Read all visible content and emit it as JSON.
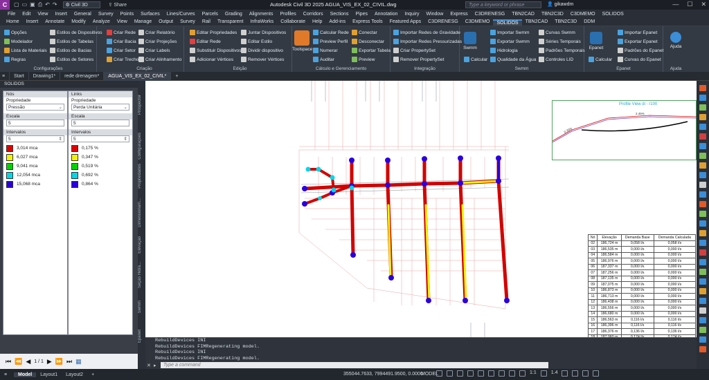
{
  "titlebar": {
    "logo": "C",
    "workspace": "Civil 3D",
    "share": "Share",
    "title": "Autodesk Civil 3D 2025   AGUA_VIS_EX_02_CIVIL.dwg",
    "search_placeholder": "Type a keyword or phrase",
    "user": "gikawdm"
  },
  "menu": [
    "File",
    "Edit",
    "View",
    "Insert",
    "General",
    "Survey",
    "Points",
    "Surfaces",
    "Lines/Curves",
    "Parcels",
    "Grading",
    "Alignments",
    "Profiles",
    "Corridors",
    "Sections",
    "Pipes",
    "Annotation",
    "Inquiry",
    "Window",
    "Express",
    "C3DRENESG",
    "TBN2CAD",
    "TBN2C3D",
    "C3DMEMO",
    "SOLIDOS"
  ],
  "ribbon_tabs": [
    "Home",
    "Insert",
    "Annotate",
    "Modify",
    "Analyze",
    "View",
    "Manage",
    "Output",
    "Survey",
    "Rail",
    "Transparent",
    "InfraWorks",
    "Collaborate",
    "Help",
    "Add-ins",
    "Express Tools",
    "Featured Apps",
    "C3DRENESG",
    "C3DMEMO",
    "SOLIDOS",
    "TBN2CAD",
    "TBN2C3D",
    "DDM"
  ],
  "ribbon": {
    "p1": {
      "title": "Configurações",
      "items": [
        "Opções",
        "Modelador",
        "Lista de Materiais",
        "Regras"
      ]
    },
    "p1b": {
      "items": [
        "Estilos de Dispositivos",
        "Estilos de Tabelas",
        "Estilos de Bacias",
        "Estilos de Setores"
      ]
    },
    "p2": {
      "title": "Criação",
      "items": [
        "Criar Rede",
        "Criar Bacia",
        "Criar Setor",
        "Criar Trecho",
        "Criar Relatório",
        "Criar Projeções",
        "Criar Labels",
        "Criar Alinhamento"
      ]
    },
    "p3": {
      "title": "Edição",
      "items": [
        "Editar Propriedades",
        "Editar Rede",
        "Substituir Dispositivos",
        "Adicionar Vértices",
        "Juntar Dispositivos",
        "Editar Estilo",
        "Dividir dispositivo",
        "Remover Vértices"
      ]
    },
    "p4": {
      "title": "Cálculo e Gerenciamento",
      "big": "Toolspace",
      "items": [
        "Calcular Rede",
        "Preview Perfil",
        "Numerar",
        "Auditar",
        "Conectar",
        "Desconectar",
        "Exportar Tabela",
        "Preview"
      ]
    },
    "p5": {
      "title": "Integração",
      "items": [
        "Importar Redes de Gravidade",
        "Importar Redes Pressurizadas",
        "Criar PropertySet",
        "Remover PropertySet"
      ]
    },
    "p6": {
      "title": "Swmm",
      "big": [
        "Swmm",
        "Calcular"
      ],
      "items": [
        "Importar Swmm",
        "Exportar Swmm",
        "Hidrologia",
        "Qualidade da Água",
        "Curvas Swmm",
        "Séries Temporais",
        "Padrões Temporais",
        "Controles LID"
      ]
    },
    "p7": {
      "title": "Epanet",
      "big": [
        "Epanet",
        "Calcular"
      ],
      "items": [
        "Importar Epanet",
        "Exportar Epanet",
        "Padrões do Epanet",
        "Curvas do Epanet"
      ]
    },
    "p8": {
      "title": "Ajuda",
      "big": "Ajuda"
    }
  },
  "doctabs": [
    "Start",
    "Drawing1*",
    "rede drenagem*",
    "AGUA_VIS_EX_02_CIVIL*"
  ],
  "left": {
    "title": "SOLIDOS",
    "nos": {
      "head": "Nós",
      "prop_label": "Propriedade",
      "prop": "Pressão",
      "scale_label": "Escala",
      "scale": "5",
      "int_label": "Intervalos",
      "intervals": "5",
      "legend": [
        {
          "v": "3,014 mca",
          "c": "#e00000"
        },
        {
          "v": "6,027 mca",
          "c": "#f3f300"
        },
        {
          "v": "9,041 mca",
          "c": "#00d400"
        },
        {
          "v": "12,054 mca",
          "c": "#00d8e8"
        },
        {
          "v": "15,068 mca",
          "c": "#2a00e0"
        }
      ]
    },
    "links": {
      "head": "Links",
      "prop_label": "Propriedade",
      "prop": "Perda Unitária",
      "scale_label": "Escala",
      "scale": "5",
      "int_label": "Intervalos",
      "intervals": "5",
      "legend": [
        {
          "v": "0,175 %",
          "c": "#e00000"
        },
        {
          "v": "0,347 %",
          "c": "#f3f300"
        },
        {
          "v": "0,519 %",
          "c": "#00d400"
        },
        {
          "v": "0,692 %",
          "c": "#00d8e8"
        },
        {
          "v": "0,864 %",
          "c": "#2a00e0"
        }
      ]
    },
    "pager": "1 / 1"
  },
  "sidetabs": [
    "Prospector",
    "Configurações",
    "Propriedades",
    "Dimensionam...",
    "Elevação",
    "Seção Hidrá...",
    "Swmm",
    "Epanet"
  ],
  "profile_title": "Profile View di - r100",
  "profile_labels": [
    "2.45%",
    "0.30%"
  ],
  "table": {
    "headers": [
      "Nó",
      "Elevação",
      "Demanda Base",
      "Demanda Calculada"
    ],
    "rows": [
      [
        "02",
        "186,724 m",
        "0,058 l/s",
        "0,058 l/s"
      ],
      [
        "03",
        "186,535 m",
        "0,000 l/s",
        "0,000 l/s"
      ],
      [
        "04",
        "186,584 m",
        "0,000 l/s",
        "0,000 l/s"
      ],
      [
        "05",
        "186,976 m",
        "0,000 l/s",
        "0,000 l/s"
      ],
      [
        "06",
        "187,337 m",
        "0,000 l/s",
        "0,000 l/s"
      ],
      [
        "07",
        "187,256 m",
        "0,000 l/s",
        "0,000 l/s"
      ],
      [
        "08",
        "187,135 m",
        "0,000 l/s",
        "0,000 l/s"
      ],
      [
        "09",
        "187,075 m",
        "0,000 l/s",
        "0,000 l/s"
      ],
      [
        "10",
        "186,873 m",
        "0,000 l/s",
        "0,000 l/s"
      ],
      [
        "11",
        "186,713 m",
        "0,000 l/s",
        "0,000 l/s"
      ],
      [
        "12",
        "186,438 m",
        "0,000 l/s",
        "0,000 l/s"
      ],
      [
        "13",
        "186,556 m",
        "0,000 l/s",
        "0,000 l/s"
      ],
      [
        "14",
        "186,680 m",
        "0,000 l/s",
        "0,000 l/s"
      ],
      [
        "15",
        "186,563 m",
        "0,116 l/s",
        "0,116 l/s"
      ],
      [
        "16",
        "186,396 m",
        "0,116 l/s",
        "0,116 l/s"
      ],
      [
        "17",
        "186,376 m",
        "0,136 l/s",
        "0,136 l/s"
      ],
      [
        "18",
        "187,060 m",
        "0,174 l/s",
        "0,174 l/s"
      ]
    ]
  },
  "commandline": [
    "RebuildDevices INI",
    "RebuildDevices FIMRegenerating model.",
    "RebuildDevices INI",
    "RebuildDevices FIMRegenerating model."
  ],
  "cmd_placeholder": "Type a command",
  "status": {
    "tabs": [
      "Model",
      "Layout1",
      "Layout2"
    ],
    "coords": "355044.7633, 7994491.9500, 0.0000",
    "mode": "MODEL",
    "scale": "1:1",
    "lineweight": "1.4"
  },
  "colors": {
    "pipe_red": "#d40000",
    "pipe_yellow": "#f3f300",
    "node_blue": "#2a00e0",
    "node_cyan": "#00d8e8",
    "accent": "#3b8ed8"
  }
}
